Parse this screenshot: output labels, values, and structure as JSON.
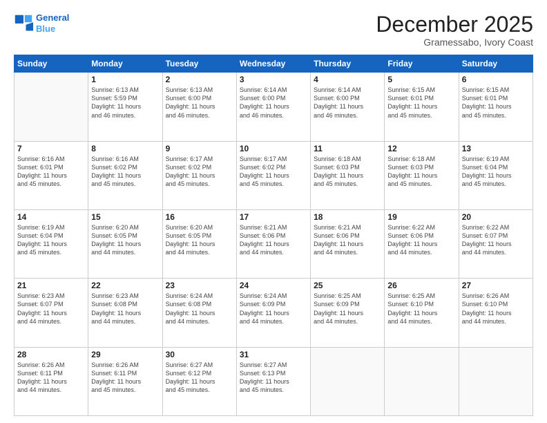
{
  "header": {
    "logo_line1": "General",
    "logo_line2": "Blue",
    "month": "December 2025",
    "location": "Gramessabo, Ivory Coast"
  },
  "days_of_week": [
    "Sunday",
    "Monday",
    "Tuesday",
    "Wednesday",
    "Thursday",
    "Friday",
    "Saturday"
  ],
  "weeks": [
    [
      {
        "num": "",
        "info": ""
      },
      {
        "num": "1",
        "info": "Sunrise: 6:13 AM\nSunset: 5:59 PM\nDaylight: 11 hours\nand 46 minutes."
      },
      {
        "num": "2",
        "info": "Sunrise: 6:13 AM\nSunset: 6:00 PM\nDaylight: 11 hours\nand 46 minutes."
      },
      {
        "num": "3",
        "info": "Sunrise: 6:14 AM\nSunset: 6:00 PM\nDaylight: 11 hours\nand 46 minutes."
      },
      {
        "num": "4",
        "info": "Sunrise: 6:14 AM\nSunset: 6:00 PM\nDaylight: 11 hours\nand 46 minutes."
      },
      {
        "num": "5",
        "info": "Sunrise: 6:15 AM\nSunset: 6:01 PM\nDaylight: 11 hours\nand 45 minutes."
      },
      {
        "num": "6",
        "info": "Sunrise: 6:15 AM\nSunset: 6:01 PM\nDaylight: 11 hours\nand 45 minutes."
      }
    ],
    [
      {
        "num": "7",
        "info": "Sunrise: 6:16 AM\nSunset: 6:01 PM\nDaylight: 11 hours\nand 45 minutes."
      },
      {
        "num": "8",
        "info": "Sunrise: 6:16 AM\nSunset: 6:02 PM\nDaylight: 11 hours\nand 45 minutes."
      },
      {
        "num": "9",
        "info": "Sunrise: 6:17 AM\nSunset: 6:02 PM\nDaylight: 11 hours\nand 45 minutes."
      },
      {
        "num": "10",
        "info": "Sunrise: 6:17 AM\nSunset: 6:02 PM\nDaylight: 11 hours\nand 45 minutes."
      },
      {
        "num": "11",
        "info": "Sunrise: 6:18 AM\nSunset: 6:03 PM\nDaylight: 11 hours\nand 45 minutes."
      },
      {
        "num": "12",
        "info": "Sunrise: 6:18 AM\nSunset: 6:03 PM\nDaylight: 11 hours\nand 45 minutes."
      },
      {
        "num": "13",
        "info": "Sunrise: 6:19 AM\nSunset: 6:04 PM\nDaylight: 11 hours\nand 45 minutes."
      }
    ],
    [
      {
        "num": "14",
        "info": "Sunrise: 6:19 AM\nSunset: 6:04 PM\nDaylight: 11 hours\nand 45 minutes."
      },
      {
        "num": "15",
        "info": "Sunrise: 6:20 AM\nSunset: 6:05 PM\nDaylight: 11 hours\nand 44 minutes."
      },
      {
        "num": "16",
        "info": "Sunrise: 6:20 AM\nSunset: 6:05 PM\nDaylight: 11 hours\nand 44 minutes."
      },
      {
        "num": "17",
        "info": "Sunrise: 6:21 AM\nSunset: 6:06 PM\nDaylight: 11 hours\nand 44 minutes."
      },
      {
        "num": "18",
        "info": "Sunrise: 6:21 AM\nSunset: 6:06 PM\nDaylight: 11 hours\nand 44 minutes."
      },
      {
        "num": "19",
        "info": "Sunrise: 6:22 AM\nSunset: 6:06 PM\nDaylight: 11 hours\nand 44 minutes."
      },
      {
        "num": "20",
        "info": "Sunrise: 6:22 AM\nSunset: 6:07 PM\nDaylight: 11 hours\nand 44 minutes."
      }
    ],
    [
      {
        "num": "21",
        "info": "Sunrise: 6:23 AM\nSunset: 6:07 PM\nDaylight: 11 hours\nand 44 minutes."
      },
      {
        "num": "22",
        "info": "Sunrise: 6:23 AM\nSunset: 6:08 PM\nDaylight: 11 hours\nand 44 minutes."
      },
      {
        "num": "23",
        "info": "Sunrise: 6:24 AM\nSunset: 6:08 PM\nDaylight: 11 hours\nand 44 minutes."
      },
      {
        "num": "24",
        "info": "Sunrise: 6:24 AM\nSunset: 6:09 PM\nDaylight: 11 hours\nand 44 minutes."
      },
      {
        "num": "25",
        "info": "Sunrise: 6:25 AM\nSunset: 6:09 PM\nDaylight: 11 hours\nand 44 minutes."
      },
      {
        "num": "26",
        "info": "Sunrise: 6:25 AM\nSunset: 6:10 PM\nDaylight: 11 hours\nand 44 minutes."
      },
      {
        "num": "27",
        "info": "Sunrise: 6:26 AM\nSunset: 6:10 PM\nDaylight: 11 hours\nand 44 minutes."
      }
    ],
    [
      {
        "num": "28",
        "info": "Sunrise: 6:26 AM\nSunset: 6:11 PM\nDaylight: 11 hours\nand 44 minutes."
      },
      {
        "num": "29",
        "info": "Sunrise: 6:26 AM\nSunset: 6:11 PM\nDaylight: 11 hours\nand 45 minutes."
      },
      {
        "num": "30",
        "info": "Sunrise: 6:27 AM\nSunset: 6:12 PM\nDaylight: 11 hours\nand 45 minutes."
      },
      {
        "num": "31",
        "info": "Sunrise: 6:27 AM\nSunset: 6:13 PM\nDaylight: 11 hours\nand 45 minutes."
      },
      {
        "num": "",
        "info": ""
      },
      {
        "num": "",
        "info": ""
      },
      {
        "num": "",
        "info": ""
      }
    ]
  ]
}
